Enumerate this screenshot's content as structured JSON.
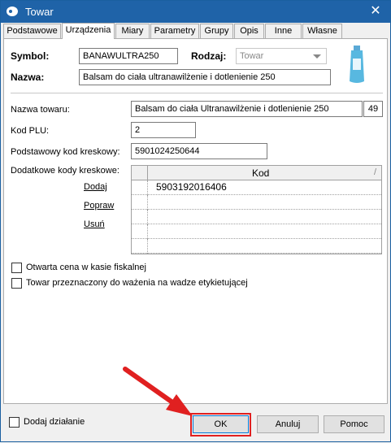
{
  "window": {
    "title": "Towar"
  },
  "tabs": [
    "Podstawowe",
    "Urządzenia",
    "Miary",
    "Parametry",
    "Grupy",
    "Opis",
    "Inne",
    "Własne"
  ],
  "header": {
    "symbol_label": "Symbol:",
    "symbol_value": "BANAWULTRA250",
    "rodzaj_label": "Rodzaj:",
    "rodzaj_value": "Towar",
    "nazwa_label": "Nazwa:",
    "nazwa_value": "Balsam do ciała ultranawilżenie i dotlenienie 250"
  },
  "form": {
    "nazwa_towaru_label": "Nazwa towaru:",
    "nazwa_towaru_value": "Balsam do ciała Ultranawilżenie i dotlenienie 250",
    "nazwa_towaru_count": "49",
    "kod_plu_label": "Kod PLU:",
    "kod_plu_value": "2",
    "kod_kreskowy_label": "Podstawowy kod kreskowy:",
    "kod_kreskowy_value": "5901024250644",
    "dodatkowe_label": "Dodatkowe kody kreskowe:"
  },
  "barcodes": {
    "column_header": "Kod",
    "sort_indicator": "/",
    "rows": [
      "5903192016406",
      "",
      "",
      "",
      ""
    ],
    "actions": {
      "add": "Dodaj",
      "edit": "Popraw",
      "delete": "Usuń"
    }
  },
  "options": {
    "open_price": "Otwarta cena w kasie fiskalnej",
    "weighing": "Towar przeznaczony do ważenia na wadze etykietującej"
  },
  "footer": {
    "add_action": "Dodaj działanie",
    "ok": "OK",
    "cancel": "Anuluj",
    "help": "Pomoc"
  },
  "colors": {
    "titlebar": "#1f63a8",
    "highlight": "#e02020",
    "arrow": "#e02020"
  }
}
